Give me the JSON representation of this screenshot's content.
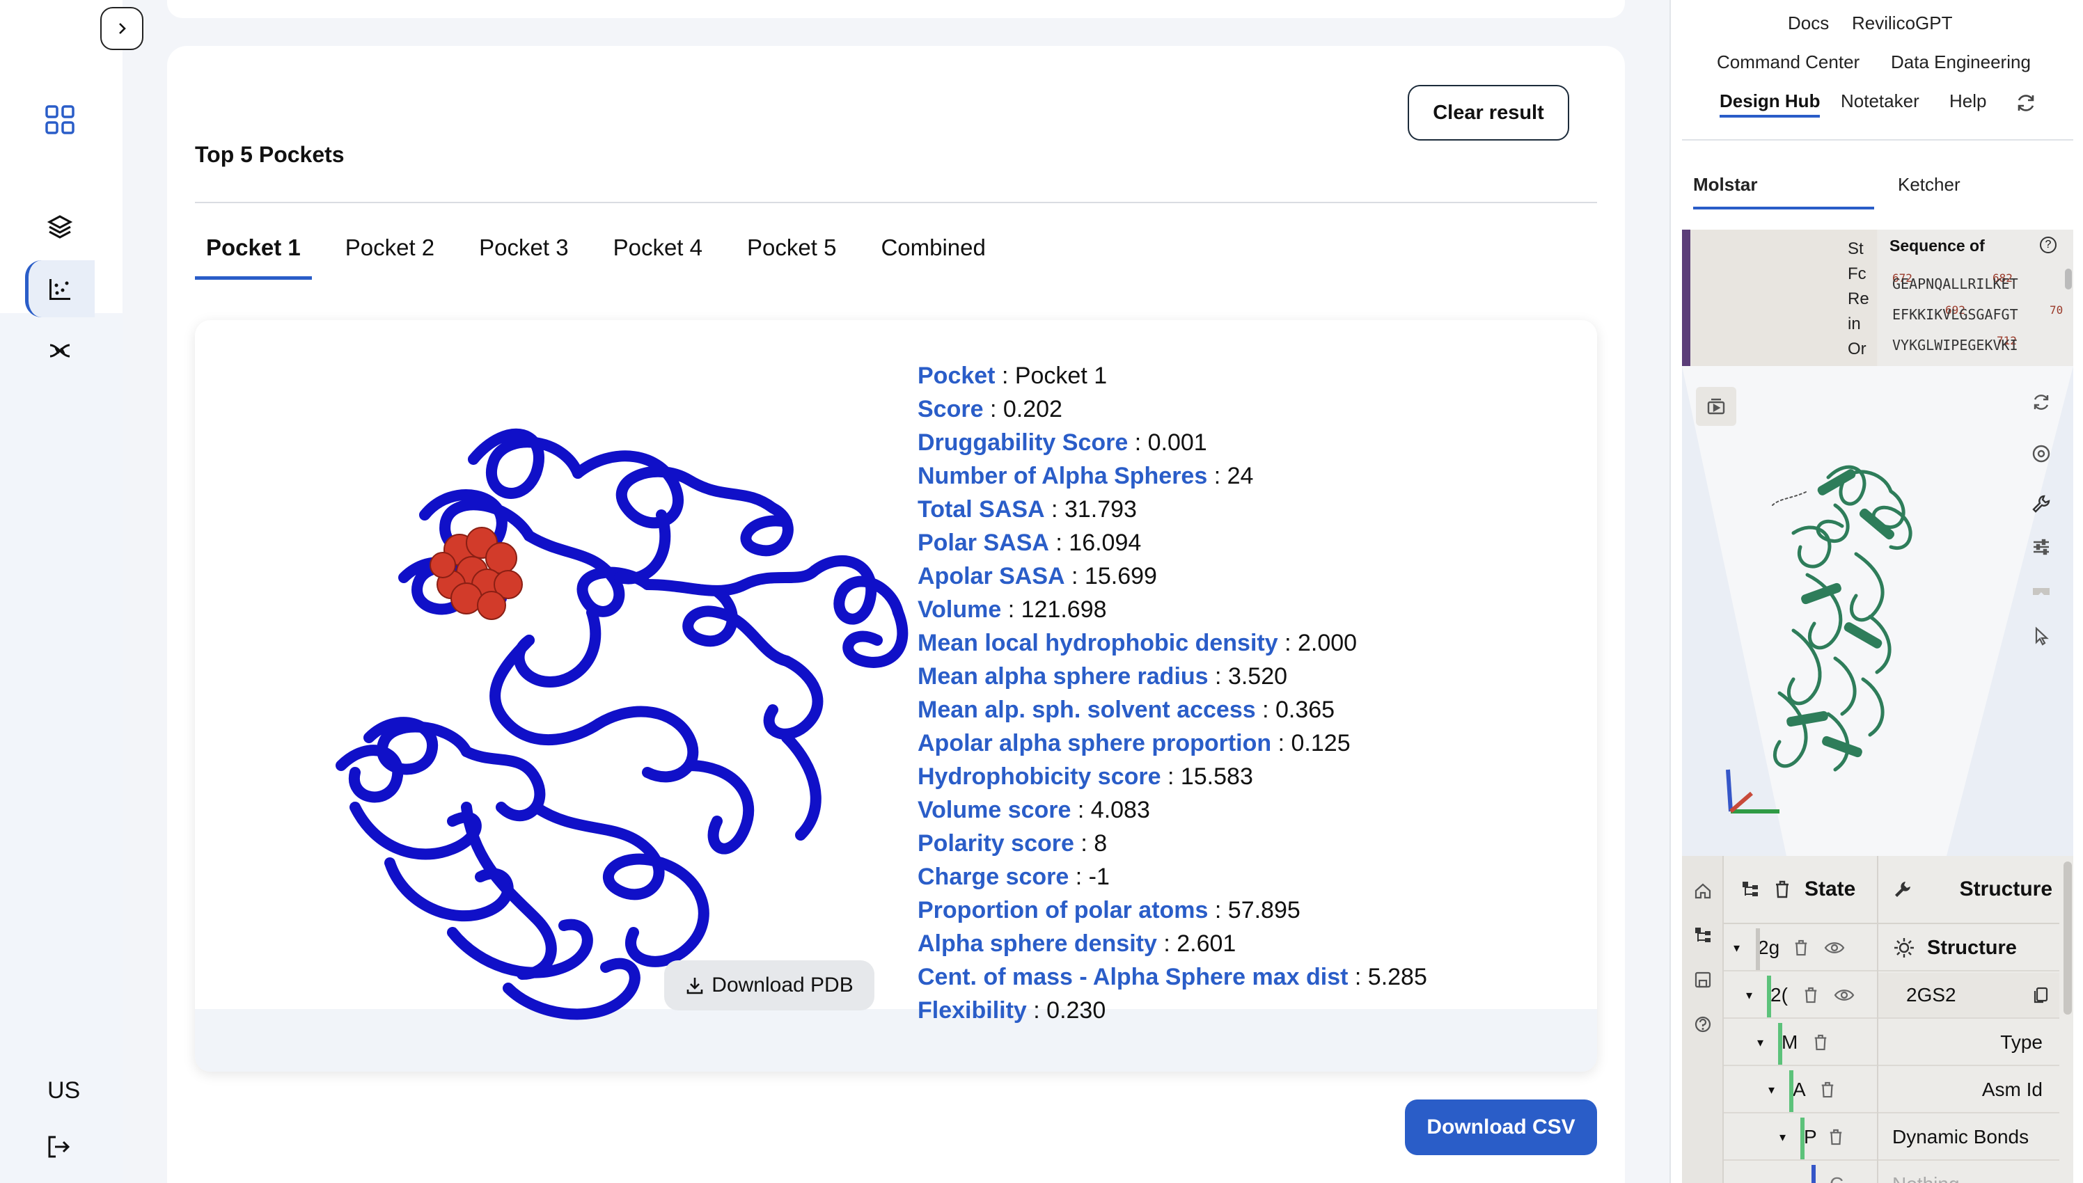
{
  "nav": {
    "user_initials": "US"
  },
  "main": {
    "clear_label": "Clear result",
    "section_title": "Top 5 Pockets",
    "tabs": [
      {
        "label": "Pocket 1",
        "active": true
      },
      {
        "label": "Pocket 2",
        "active": false
      },
      {
        "label": "Pocket 3",
        "active": false
      },
      {
        "label": "Pocket 4",
        "active": false
      },
      {
        "label": "Pocket 5",
        "active": false
      },
      {
        "label": "Combined",
        "active": false
      }
    ],
    "download_pdb_label": "Download PDB",
    "download_csv_label": "Download CSV",
    "properties": [
      {
        "key": "Pocket",
        "value": "Pocket 1"
      },
      {
        "key": "Score",
        "value": "0.202"
      },
      {
        "key": "Druggability Score",
        "value": "0.001"
      },
      {
        "key": "Number of Alpha Spheres",
        "value": "24"
      },
      {
        "key": "Total SASA",
        "value": "31.793"
      },
      {
        "key": "Polar SASA",
        "value": "16.094"
      },
      {
        "key": "Apolar SASA",
        "value": "15.699"
      },
      {
        "key": "Volume",
        "value": "121.698"
      },
      {
        "key": "Mean local hydrophobic density",
        "value": "2.000"
      },
      {
        "key": "Mean alpha sphere radius",
        "value": "3.520"
      },
      {
        "key": "Mean alp. sph. solvent access",
        "value": "0.365"
      },
      {
        "key": "Apolar alpha sphere proportion",
        "value": "0.125"
      },
      {
        "key": "Hydrophobicity score",
        "value": "15.583"
      },
      {
        "key": "Volume score",
        "value": "4.083"
      },
      {
        "key": "Polarity score",
        "value": "8"
      },
      {
        "key": "Charge score",
        "value": "-1"
      },
      {
        "key": "Proportion of polar atoms",
        "value": "57.895"
      },
      {
        "key": "Alpha sphere density",
        "value": "2.601"
      },
      {
        "key": "Cent. of mass - Alpha Sphere max dist",
        "value": "5.285"
      },
      {
        "key": "Flexibility",
        "value": "0.230"
      }
    ],
    "protein_color": "#1010c8",
    "pocket_color": "#d23b2a"
  },
  "right": {
    "links": {
      "docs": "Docs",
      "revilico_gpt": "RevilicoGPT",
      "command_center": "Command Center",
      "data_engineering": "Data Engineering",
      "design_hub": "Design Hub",
      "notetaker": "Notetaker",
      "help": "Help"
    },
    "subtabs": {
      "molstar": "Molstar",
      "ketcher": "Ketcher"
    },
    "sequence": {
      "title": "Sequence of",
      "left_letters": [
        "St",
        "Fc",
        "Re",
        "in",
        "Or"
      ],
      "lines": [
        "GEAPNQALLRILKET",
        "EFKKIKVLGSGAFGT",
        "VYKGLWIPEGEKVKI"
      ],
      "numbers": [
        "672",
        "682",
        "692",
        "70",
        "712"
      ]
    },
    "tree": {
      "state_label": "State",
      "structure_header": "Structure",
      "structure_title": "Structure",
      "rows": [
        {
          "label": "2g"
        },
        {
          "label": "2("
        },
        {
          "label": "M"
        },
        {
          "label": "A"
        },
        {
          "label": "P"
        },
        {
          "label": "C"
        }
      ],
      "props": [
        {
          "value": "2GS2"
        },
        {
          "value": "Type"
        },
        {
          "value": "Asm Id"
        },
        {
          "value": "Dynamic Bonds"
        },
        {
          "value": "Nothing"
        }
      ]
    },
    "structure_color": "#2e7d5a"
  }
}
